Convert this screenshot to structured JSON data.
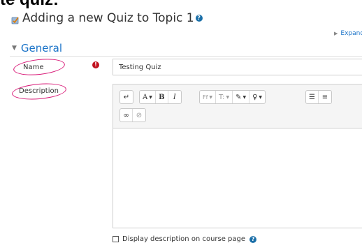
{
  "top_partial_text": "te quiz:",
  "page": {
    "title": "Adding a new Quiz to Topic 1",
    "help_glyph": "?",
    "expand_link": "Expand c"
  },
  "section": {
    "title": "General"
  },
  "fields": {
    "name_label": "Name",
    "name_value": "Testing Quiz",
    "required_glyph": "!",
    "description_label": "Description"
  },
  "toolbar": {
    "row1": [
      {
        "name": "toggle-toolbar-button",
        "label": "↵",
        "icon": "collapse-icon"
      },
      {
        "name": "font-color-button",
        "label": "A",
        "dropdown": true,
        "icon": "text-color-icon"
      },
      {
        "name": "bold-button",
        "label": "B"
      },
      {
        "name": "italic-button",
        "label": "I"
      },
      {
        "name": "font-family-button",
        "label": "Ff",
        "dropdown": true
      },
      {
        "name": "font-size-button",
        "label": "T:",
        "dropdown": true
      },
      {
        "name": "highlight-button",
        "label": "✎",
        "dropdown": true,
        "icon": "brush-icon"
      },
      {
        "name": "insert-button",
        "label": "♀",
        "dropdown": true,
        "icon": "lightbulb-icon"
      },
      {
        "name": "bullet-list-button",
        "label": "☰",
        "icon": "unordered-list-icon"
      },
      {
        "name": "numbered-list-button",
        "label": "≡",
        "icon": "ordered-list-icon"
      }
    ],
    "row2": [
      {
        "name": "link-button",
        "label": "∞",
        "icon": "link-icon"
      },
      {
        "name": "unlink-button",
        "label": "⊘",
        "icon": "unlink-icon"
      }
    ]
  },
  "display_option": {
    "label": "Display description on course page",
    "checked": false
  },
  "colors": {
    "accent": "#1a73c8",
    "annotation": "#d81b78",
    "required": "#c1121f"
  }
}
